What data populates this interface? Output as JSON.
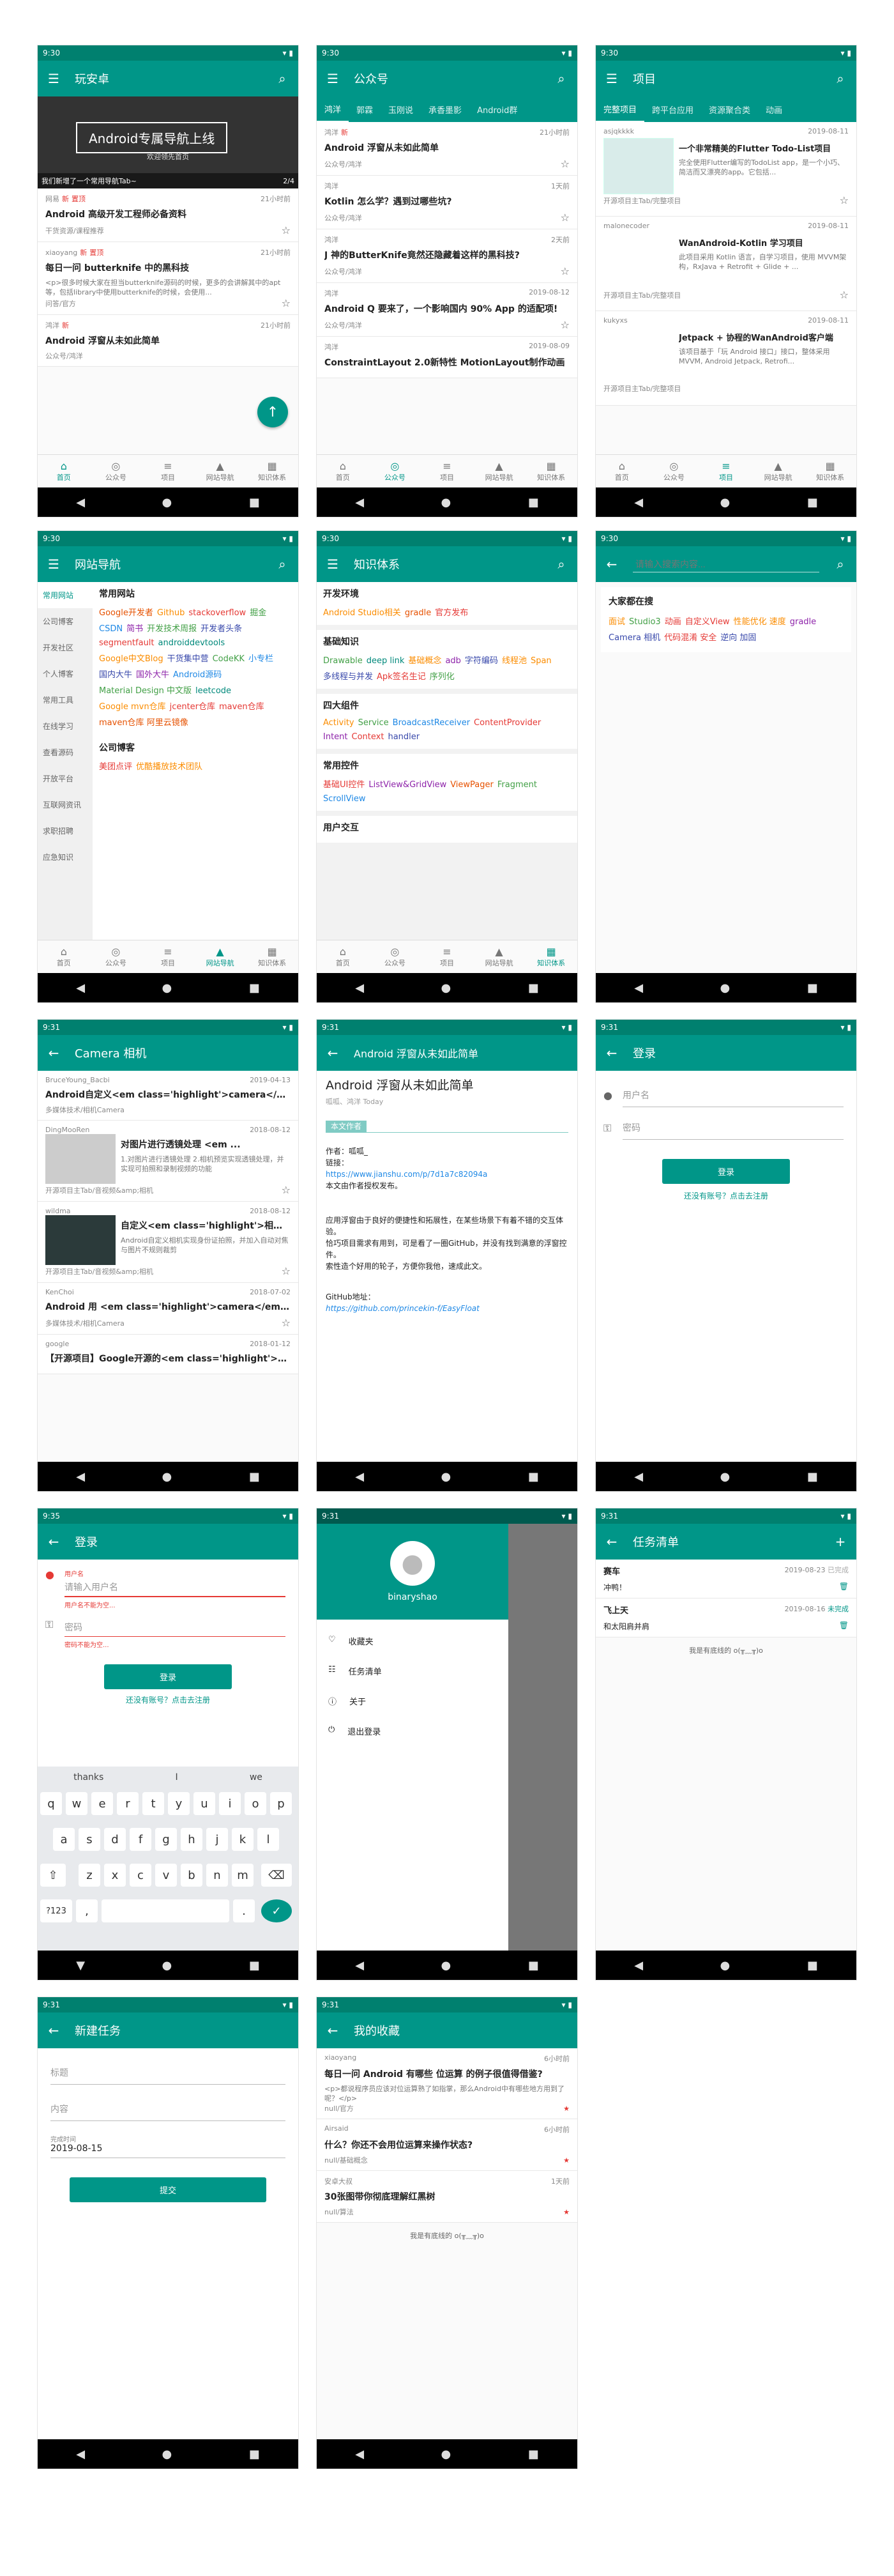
{
  "status_time": "9:30",
  "status_time_b": "9:31",
  "status_time_c": "9:35",
  "nav": {
    "home": "首页",
    "wechat": "公众号",
    "project": "项目",
    "navi": "网站导航",
    "tree": "知识体系"
  },
  "p1": {
    "title": "玩安卓",
    "banner_text": "Android专属导航上线",
    "banner_sub": "欢迎领先首页",
    "banner_caption": "我们新增了一个常用导航Tab~",
    "banner_page": "2/4",
    "items": [
      {
        "author": "网易",
        "tag1": "新",
        "tag2": "置顶",
        "time": "21小时前",
        "title": "Android 高级开发工程师必备资料",
        "chapter": "干货资源/课程推荐"
      },
      {
        "author": "xiaoyang",
        "tag1": "新",
        "tag2": "置顶",
        "time": "21小时前",
        "title": "每日一问 butterknife 中的黑科技",
        "desc": "<p>很多时候大家在担当butterknife源码的时候，更多的会讲解其中的apt等，包括library中使用butterknife的时候，会使用...",
        "chapter": "问答/官方"
      },
      {
        "author": "鸿洋",
        "tag1": "新",
        "time": "21小时前",
        "title": "Android 浮窗从未如此简单",
        "chapter": "公众号/鸿洋"
      }
    ]
  },
  "p2": {
    "title": "公众号",
    "tabs": [
      "鸿洋",
      "郭霖",
      "玉刚说",
      "承香墨影",
      "Android群"
    ],
    "items": [
      {
        "author": "鸿洋",
        "tag1": "新",
        "time": "21小时前",
        "title": "Android 浮窗从未如此简单",
        "chapter": "公众号/鸿洋"
      },
      {
        "author": "鸿洋",
        "time": "1天前",
        "title": "Kotlin 怎么学？遇到过哪些坑?",
        "chapter": "公众号/鸿洋"
      },
      {
        "author": "鸿洋",
        "time": "2天前",
        "title": "J 神的ButterKnife竟然还隐藏着这样的黑科技?",
        "chapter": "公众号/鸿洋"
      },
      {
        "author": "鸿洋",
        "time": "2019-08-12",
        "title": "Android Q 要来了，一个影响国内 90% App 的适配项!",
        "chapter": "公众号/鸿洋"
      },
      {
        "author": "鸿洋",
        "time": "2019-08-09",
        "title": "ConstraintLayout 2.0新特性 MotionLayout制作动画",
        "chapter": "公众号/鸿洋"
      }
    ]
  },
  "p3": {
    "title": "项目",
    "tabs": [
      "完整项目",
      "跨平台应用",
      "资源聚合类",
      "动画"
    ],
    "items": [
      {
        "author": "asjqkkkk",
        "time": "2019-08-11",
        "title": "一个非常精美的Flutter Todo-List项目",
        "desc": "完全使用Flutter编写的TodoList app，是一个小巧、简洁而又漂亮的app。它包括...",
        "chapter": "开源项目主Tab/完整项目"
      },
      {
        "author": "malonecoder",
        "time": "2019-08-11",
        "title": "WanAndroid-Kotlin 学习项目",
        "desc": "此项目采用 Kotlin 语言，自学习项目，使用 MVVM架构，RxJava + Retrofit + Glide + ...",
        "chapter": "开源项目主Tab/完整项目"
      },
      {
        "author": "kukyxs",
        "time": "2019-08-11",
        "title": "Jetpack + 协程的WanAndroid客户端",
        "desc": "该项目基于「玩 Android 接口」接口，整体采用 MVVM, Android Jetpack, Retrofi...",
        "chapter": "开源项目主Tab/完整项目"
      }
    ]
  },
  "p4": {
    "title": "网站导航",
    "side": [
      "常用网站",
      "公司博客",
      "开发社区",
      "个人博客",
      "常用工具",
      "在线学习",
      "查看源码",
      "开放平台",
      "互联网资讯",
      "求职招聘",
      "应急知识"
    ],
    "head1": "常用网站",
    "links": [
      "Google开发者",
      "Github",
      "stackoverflow",
      "掘金",
      "CSDN",
      "简书",
      "开发技术周报",
      "开发者头条",
      "segmentfault",
      "androiddevtools",
      "Google中文Blog",
      "干货集中营",
      "CodeKK",
      "小专栏",
      "国内大牛",
      "国外大牛",
      "Android源码",
      "Material Design 中文版",
      "leetcode",
      "Google mvn仓库",
      "jcenter仓库",
      "maven仓库",
      "maven仓库 阿里云镜像"
    ],
    "head2": "公司博客",
    "links2": [
      "美团点评",
      "优酷播放技术团队"
    ]
  },
  "p5": {
    "title": "知识体系",
    "sections": [
      {
        "name": "开发环境",
        "items": [
          "Android Studio相关",
          "gradle",
          "官方发布"
        ]
      },
      {
        "name": "基础知识",
        "items": [
          "Drawable",
          "deep link",
          "基础概念",
          "adb",
          "字符编码",
          "线程池",
          "Span",
          "多线程与并发",
          "Apk签名生记",
          "序列化"
        ]
      },
      {
        "name": "四大组件",
        "items": [
          "Activity",
          "Service",
          "BroadcastReceiver",
          "ContentProvider",
          "Intent",
          "Context",
          "handler"
        ]
      },
      {
        "name": "常用控件",
        "items": [
          "基础UI控件",
          "ListView&GridView",
          "ViewPager",
          "Fragment",
          "ScrollView"
        ]
      },
      {
        "name": "用户交互",
        "items": []
      }
    ]
  },
  "p6": {
    "search_placeholder": "请输入搜索内容...",
    "head": "大家都在搜",
    "words": [
      "面试",
      "Studio3",
      "动画",
      "自定义View",
      "性能优化 速度",
      "gradle",
      "Camera 相机",
      "代码混淆 安全",
      "逆向 加固"
    ]
  },
  "p7": {
    "title": "Camera 相机",
    "items": [
      {
        "author": "BruceYoung_Bacbi",
        "time": "2019-04-13",
        "title": "Android自定义<em class='highlight'>camera</em><em>...",
        "chapter": "多媒体技术/相机Camera"
      },
      {
        "author": "DingMooRen",
        "time": "2018-08-12",
        "title": "对图片进行透镜处理 <em ...",
        "desc": "1.对图片进行透镜处理 2.相机预览实现透镜处理，并实现可拍照和录制视频的功能",
        "chapter": "开源项目主Tab/音视频&amp;相机"
      },
      {
        "author": "wildma",
        "time": "2018-08-12",
        "title": "自定义<em class='highlight'>相机...",
        "desc": "Android自定义相机实现身份证拍照，并加入自动对焦与图片不规则裁剪",
        "chapter": "开源项目主Tab/音视频&amp;相机"
      },
      {
        "author": "KenChoi",
        "time": "2018-07-02",
        "title": "Android 用 <em class='highlight'>camera</em2 API...",
        "chapter": "多媒体技术/相机Camera"
      },
      {
        "author": "google",
        "time": "2018-01-12",
        "title": "【开源项目】Google开源的<em class='highlight'>相...",
        "chapter": ""
      }
    ]
  },
  "p8": {
    "title": "Android 浮窗从未如此简单",
    "h1": "Android 浮窗从未如此简单",
    "sub": "呱呱、鸿洋 Today",
    "quote": "本文作者",
    "author": "作者：呱呱_",
    "link_label": "链接：",
    "link": "https://www.jianshu.com/p/7d1a7c82094a",
    "right": "本文由作者授权发布。",
    "para1": "应用浮窗由于良好的便捷性和拓展性，在某些场景下有着不错的交互体验。",
    "para2": "恰巧项目需求有用到，可是看了一圈GitHub，并没有找到满意的浮窗控件。",
    "para3": "索性造个好用的轮子，方便你我他，速成此文。",
    "gh": "GitHub地址：",
    "gh_link": "https://github.com/princekin-f/EasyFloat"
  },
  "p9": {
    "title": "登录",
    "user": "用户名",
    "pwd": "密码",
    "btn": "登录",
    "reg": "还没有账号？点击去注册"
  },
  "p10": {
    "title": "登录",
    "user_label": "用户名",
    "user_ph": "请输入用户名",
    "user_err": "用户名不能为空...",
    "pwd": "密码",
    "pwd_err": "密码不能为空...",
    "btn": "登录",
    "reg": "还没有账号？点击去注册",
    "sugg": [
      "thanks",
      "I",
      "we"
    ],
    "row1": [
      "q",
      "w",
      "e",
      "r",
      "t",
      "y",
      "u",
      "i",
      "o",
      "p"
    ],
    "row2": [
      "a",
      "s",
      "d",
      "f",
      "g",
      "h",
      "j",
      "k",
      "l"
    ],
    "row3": [
      "z",
      "x",
      "c",
      "v",
      "b",
      "n",
      "m"
    ],
    "num": "?123"
  },
  "p11": {
    "user": "binaryshao",
    "menu": [
      "收藏夹",
      "任务清单",
      "关于",
      "退出登录"
    ]
  },
  "p12": {
    "title": "任务清单",
    "items": [
      {
        "name": "赛车",
        "date": "2019-08-23",
        "state": "已完成",
        "note": "冲鸭！"
      },
      {
        "name": "飞上天",
        "date": "2019-08-16",
        "state": "未完成",
        "note": "和太阳肩并肩"
      }
    ],
    "end": "我是有底线的 o(╥﹏╥)o"
  },
  "p13": {
    "title": "新建任务",
    "f1": "标题",
    "f2": "内容",
    "date_label": "完成时间",
    "date": "2019-08-15",
    "btn": "提交"
  },
  "p14": {
    "title": "我的收藏",
    "items": [
      {
        "author": "xiaoyang",
        "time": "6小时前",
        "title": "每日一问  Android 有哪些 位运算 的例子很值得借鉴?",
        "desc": "<p>都说程序员应该对位运算熟了如指掌，那么Android中有哪些地方用到了呢？</p>",
        "chapter": "null/官方"
      },
      {
        "author": "Airsaid",
        "time": "6小时前",
        "title": "什么？你还不会用位运算来操作状态?",
        "chapter": "null/基础概念"
      },
      {
        "author": "安卓大叔",
        "time": "1天前",
        "title": "30张图带你彻底理解红黑树",
        "chapter": "null/算法"
      }
    ],
    "end": "我是有底线的 o(╥﹏╥)o"
  }
}
